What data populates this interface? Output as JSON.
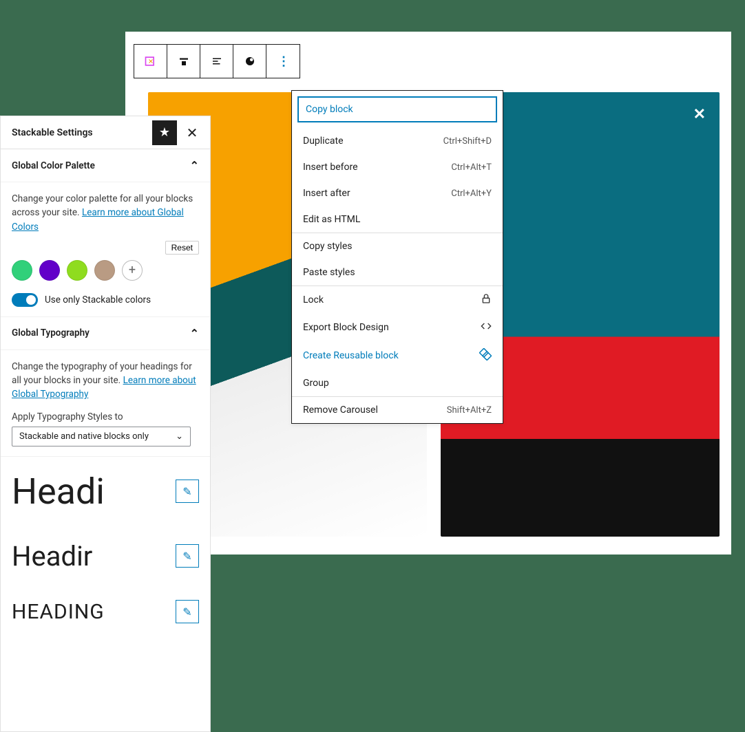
{
  "toolbar": {
    "icons": [
      "block-icon",
      "align-icon",
      "justify-icon",
      "style-icon",
      "more-icon"
    ]
  },
  "dropdown": {
    "copy_block": "Copy block",
    "duplicate": {
      "label": "Duplicate",
      "kbd": "Ctrl+Shift+D"
    },
    "insert_before": {
      "label": "Insert before",
      "kbd": "Ctrl+Alt+T"
    },
    "insert_after": {
      "label": "Insert after",
      "kbd": "Ctrl+Alt+Y"
    },
    "edit_html": "Edit as HTML",
    "copy_styles": "Copy styles",
    "paste_styles": "Paste styles",
    "lock": "Lock",
    "export_design": "Export Block Design",
    "create_reusable": "Create Reusable block",
    "group": "Group",
    "remove": {
      "label": "Remove Carousel",
      "kbd": "Shift+Alt+Z"
    }
  },
  "sidebar": {
    "title": "Stackable Settings",
    "color_section": {
      "title": "Global Color Palette",
      "description_pre": "Change your color palette for all your blocks across your site. ",
      "learn_more": "Learn more about Global Colors",
      "reset": "Reset",
      "swatches": [
        "#31d07a",
        "#6200c9",
        "#8fdc1f",
        "#b99b83"
      ],
      "toggle_label": "Use only Stackable colors"
    },
    "typo_section": {
      "title": "Global Typography",
      "description_pre": "Change the typography of your headings for all your blocks in your site. ",
      "learn_more": "Learn more about Global Typography",
      "apply_label": "Apply Typography Styles to",
      "select_value": "Stackable and native blocks only"
    },
    "headings": {
      "h1": "Headi",
      "h2": "Headir",
      "h3": "HEADING"
    }
  }
}
